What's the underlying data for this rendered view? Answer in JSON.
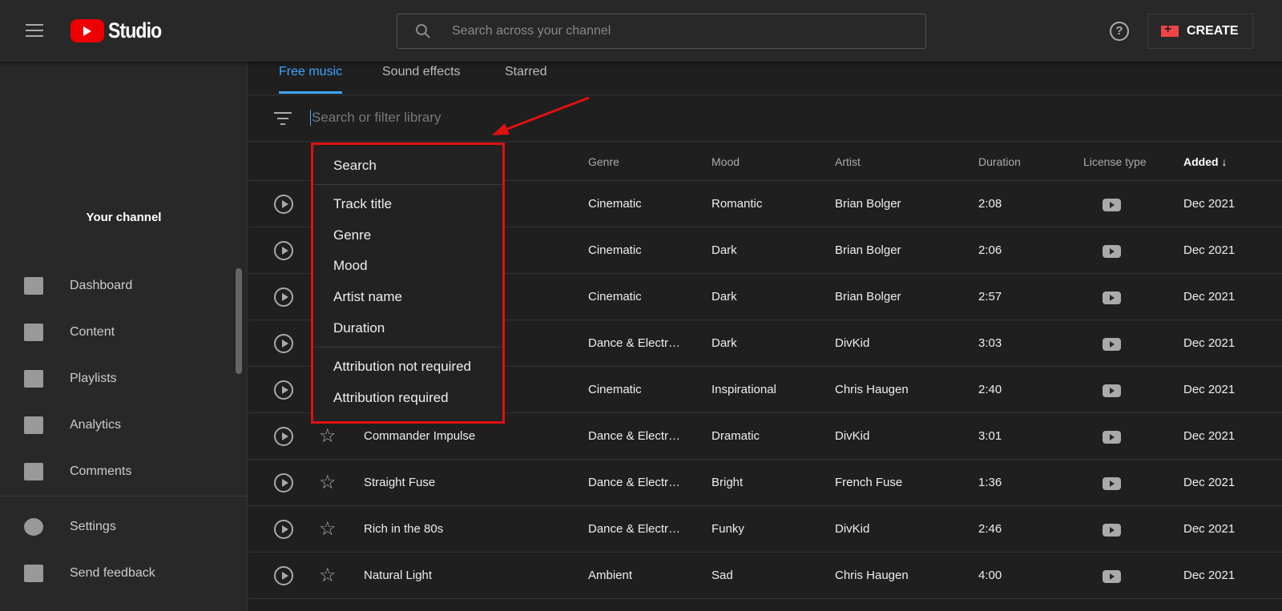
{
  "header": {
    "logo_text": "Studio",
    "search_placeholder": "Search across your channel",
    "create_label": "CREATE",
    "help_label": "?"
  },
  "sidebar": {
    "channel_label": "Your channel",
    "items": [
      {
        "label": "Dashboard",
        "icon": "dashboard-icon"
      },
      {
        "label": "Content",
        "icon": "content-icon"
      },
      {
        "label": "Playlists",
        "icon": "playlists-icon"
      },
      {
        "label": "Analytics",
        "icon": "analytics-icon"
      },
      {
        "label": "Comments",
        "icon": "comments-icon"
      },
      {
        "label": "Settings",
        "icon": "gear-icon"
      },
      {
        "label": "Send feedback",
        "icon": "feedback-icon"
      }
    ]
  },
  "tabs": [
    {
      "label": "Free music",
      "active": true
    },
    {
      "label": "Sound effects"
    },
    {
      "label": "Starred"
    }
  ],
  "filter": {
    "placeholder": "Search or filter library"
  },
  "columns": {
    "genre": "Genre",
    "mood": "Mood",
    "artist": "Artist",
    "duration": "Duration",
    "license": "License type",
    "added": "Added ↓"
  },
  "rows": [
    {
      "title": "",
      "genre": "Cinematic",
      "mood": "Romantic",
      "artist": "Brian Bolger",
      "duration": "2:08",
      "added": "Dec 2021"
    },
    {
      "title": "",
      "genre": "Cinematic",
      "mood": "Dark",
      "artist": "Brian Bolger",
      "duration": "2:06",
      "added": "Dec 2021"
    },
    {
      "title": "",
      "genre": "Cinematic",
      "mood": "Dark",
      "artist": "Brian Bolger",
      "duration": "2:57",
      "added": "Dec 2021"
    },
    {
      "title": "",
      "genre": "Dance & Electr…",
      "mood": "Dark",
      "artist": "DivKid",
      "duration": "3:03",
      "added": "Dec 2021"
    },
    {
      "title": "",
      "genre": "Cinematic",
      "mood": "Inspirational",
      "artist": "Chris Haugen",
      "duration": "2:40",
      "added": "Dec 2021"
    },
    {
      "title": "Commander Impulse",
      "genre": "Dance & Electr…",
      "mood": "Dramatic",
      "artist": "DivKid",
      "duration": "3:01",
      "added": "Dec 2021"
    },
    {
      "title": "Straight Fuse",
      "genre": "Dance & Electr…",
      "mood": "Bright",
      "artist": "French Fuse",
      "duration": "1:36",
      "added": "Dec 2021"
    },
    {
      "title": "Rich in the 80s",
      "genre": "Dance & Electr…",
      "mood": "Funky",
      "artist": "DivKid",
      "duration": "2:46",
      "added": "Dec 2021"
    },
    {
      "title": "Natural Light",
      "genre": "Ambient",
      "mood": "Sad",
      "artist": "Chris Haugen",
      "duration": "4:00",
      "added": "Dec 2021"
    }
  ],
  "filter_menu": {
    "items": [
      "Search",
      "Track title",
      "Genre",
      "Mood",
      "Artist name",
      "Duration",
      "Attribution not required",
      "Attribution required"
    ]
  },
  "colors": {
    "accent": "#3ea6ff",
    "highlight": "#dd1111"
  }
}
